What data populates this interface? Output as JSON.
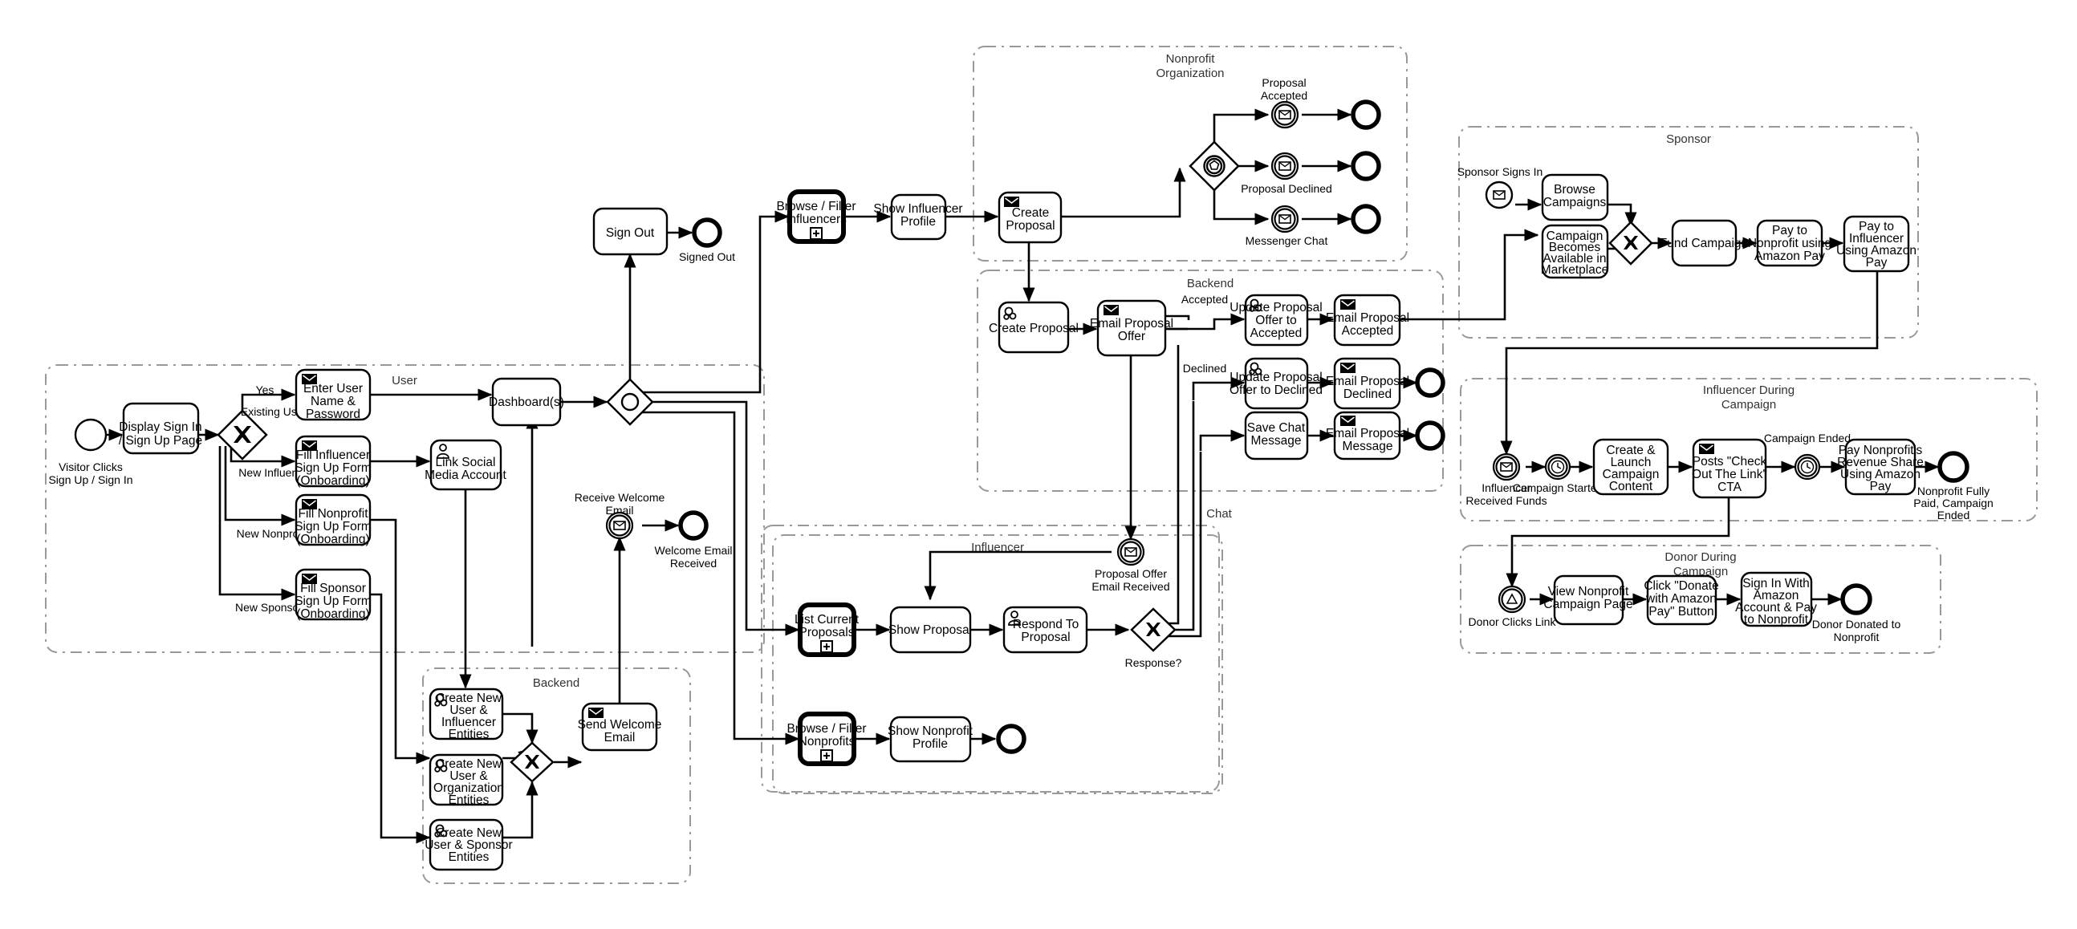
{
  "diagram": {
    "title": "Influencer / Nonprofit / Sponsor Platform BPMN Process",
    "background": "#ffffff",
    "line_color": "#000000",
    "pool_border_color": "#999999"
  },
  "pools": {
    "user": "User",
    "backend_signup": "Backend",
    "nonprofit_org": "Nonprofit\nOrganization",
    "backend_proposal": "Backend",
    "chat": "Chat",
    "influencer": "Influencer",
    "sponsor": "Sponsor",
    "influencer_campaign": "Influencer During\nCampaign",
    "donor_campaign": "Donor During\nCampaign"
  },
  "pool_labels": {
    "nonprofit_org_l1": "Nonprofit",
    "nonprofit_org_l2": "Organization",
    "influencer_campaign_l1": "Influencer During",
    "influencer_campaign_l2": "Campaign",
    "donor_campaign_l1": "Donor During",
    "donor_campaign_l2": "Campaign"
  },
  "user_flow": {
    "start_event_label_l1": "Visitor Clicks",
    "start_event_label_l2": "Sign Up / Sign In",
    "display_signin_l1": "Display Sign In",
    "display_signin_l2": "/ Sign Up Page",
    "gateway_label": "Existing User?",
    "branch_yes": "Yes",
    "branch_new_influencer": "New Influencer",
    "branch_new_nonprofit": "New Nonprofit",
    "branch_new_sponsor": "New Sponsor",
    "enter_user_l1": "Enter User",
    "enter_user_l2": "Name &",
    "enter_user_l3": "Password",
    "fill_influencer_l1": "Fill Influencer",
    "fill_influencer_l2": "Sign Up Form",
    "fill_influencer_l3": "(Onboarding)",
    "fill_nonprofit_l1": "Fill Nonprofit",
    "fill_nonprofit_l2": "Sign Up Form",
    "fill_nonprofit_l3": "(Onboarding)",
    "fill_sponsor_l1": "Fill Sponsor",
    "fill_sponsor_l2": "Sign Up Form",
    "fill_sponsor_l3": "(Onboarding)",
    "link_social_l1": "Link Social",
    "link_social_l2": "Media Account",
    "dashboard": "Dashboard(s)",
    "sign_out": "Sign Out",
    "signed_out": "Signed Out",
    "receive_welcome_l1": "Receive Welcome",
    "receive_welcome_l2": "Email",
    "welcome_received_l1": "Welcome Email",
    "welcome_received_l2": "Received"
  },
  "backend_signup_flow": {
    "create_influencer_l1": "Create New",
    "create_influencer_l2": "User &",
    "create_influencer_l3": "Influencer",
    "create_influencer_l4": "Entities",
    "create_org_l1": "Create New",
    "create_org_l2": "User &",
    "create_org_l3": "Organization",
    "create_org_l4": "Entities",
    "create_sponsor_l1": "Create New",
    "create_sponsor_l2": "User & Sponsor",
    "create_sponsor_l3": "Entities",
    "send_welcome_l1": "Send Welcome",
    "send_welcome_l2": "Email"
  },
  "nonprofit_flow": {
    "browse_influencers_l1": "Browse / Filter",
    "browse_influencers_l2": "Influencers",
    "show_influencer_l1": "Show Influencer",
    "show_influencer_l2": "Profile",
    "create_proposal_l1": "Create",
    "create_proposal_l2": "Proposal",
    "proposal_accepted_l1": "Proposal",
    "proposal_accepted_l2": "Accepted",
    "proposal_declined": "Proposal Declined",
    "messenger_chat": "Messenger Chat"
  },
  "backend_proposal_flow": {
    "create_proposal": "Create Proposal",
    "email_proposal_offer_l1": "Email Proposal",
    "email_proposal_offer_l2": "Offer",
    "branch_accepted": "Accepted",
    "branch_declined": "Declined",
    "update_accepted_l1": "Update Proposal",
    "update_accepted_l2": "Offer to",
    "update_accepted_l3": "Accepted",
    "update_declined_l1": "Update Proposal",
    "update_declined_l2": "Offer to Declined",
    "save_chat_l1": "Save Chat",
    "save_chat_l2": "Message",
    "email_accepted_l1": "Email Proposal",
    "email_accepted_l2": "Accepted",
    "email_declined_l1": "Email Proposal",
    "email_declined_l2": "Declined",
    "email_message_l1": "Email Proposal",
    "email_message_l2": "Message"
  },
  "influencer_flow": {
    "proposal_offer_email_l1": "Proposal Offer",
    "proposal_offer_email_l2": "Email Received",
    "list_proposals_l1": "List Current",
    "list_proposals_l2": "Proposals",
    "show_proposal": "Show Proposal",
    "respond_to_proposal_l1": "Respond To",
    "respond_to_proposal_l2": "Proposal",
    "response_gateway": "Response?",
    "browse_nonprofits_l1": "Browse / Filter",
    "browse_nonprofits_l2": "Nonprofits",
    "show_nonprofit_l1": "Show Nonprofit",
    "show_nonprofit_l2": "Profile"
  },
  "sponsor_flow": {
    "sponsor_signs_in": "Sponsor Signs In",
    "browse_campaigns_l1": "Browse",
    "browse_campaigns_l2": "Campaigns",
    "campaign_available_l1": "Campaign",
    "campaign_available_l2": "Becomes",
    "campaign_available_l3": "Available in",
    "campaign_available_l4": "Marketplace",
    "fund_campaign": "Fund Campaign",
    "pay_nonprofit_l1": "Pay to",
    "pay_nonprofit_l2": "Nonprofit using",
    "pay_nonprofit_l3": "Amazon Pay",
    "pay_influencer_l1": "Pay to",
    "pay_influencer_l2": "Influencer",
    "pay_influencer_l3": "Using Amazon",
    "pay_influencer_l4": "Pay"
  },
  "influencer_campaign_flow": {
    "received_funds_l1": "Influencer",
    "received_funds_l2": "Received Funds",
    "campaign_started": "Campaign Started",
    "create_launch_l1": "Create &",
    "create_launch_l2": "Launch",
    "create_launch_l3": "Campaign",
    "create_launch_l4": "Content",
    "posts_cta_l1": "Posts \"Check",
    "posts_cta_l2": "Out The Link\"",
    "posts_cta_l3": "CTA",
    "campaign_ended": "Campaign Ended",
    "pay_revenue_l1": "Pay Nonprofit's",
    "pay_revenue_l2": "Revenue Share",
    "pay_revenue_l3": "Using Amazon",
    "pay_revenue_l4": "Pay",
    "end_l1": "Nonprofit Fully",
    "end_l2": "Paid, Campaign",
    "end_l3": "Ended"
  },
  "donor_campaign_flow": {
    "donor_clicks_link": "Donor Clicks Link",
    "view_page_l1": "View Nonprofit",
    "view_page_l2": "Campaign Page",
    "click_donate_l1": "Click \"Donate",
    "click_donate_l2": "with Amazon",
    "click_donate_l3": "Pay\" Button",
    "sign_in_pay_l1": "Sign In With",
    "sign_in_pay_l2": "Amazon",
    "sign_in_pay_l3": "Account & Pay",
    "sign_in_pay_l4": "to Nonprofit",
    "end_l1": "Donor Donated to",
    "end_l2": "Nonprofit"
  },
  "icons": {
    "envelope": "envelope-icon",
    "gears": "gears-icon",
    "user": "user-icon",
    "clock": "clock-icon",
    "triangle": "triangle-icon",
    "plus_marker": "subprocess-plus-marker",
    "x_gateway": "exclusive-gateway-x-icon",
    "circle_gateway": "inclusive-gateway-circle-icon",
    "pentagon_gateway": "event-based-gateway-pentagon-icon"
  }
}
